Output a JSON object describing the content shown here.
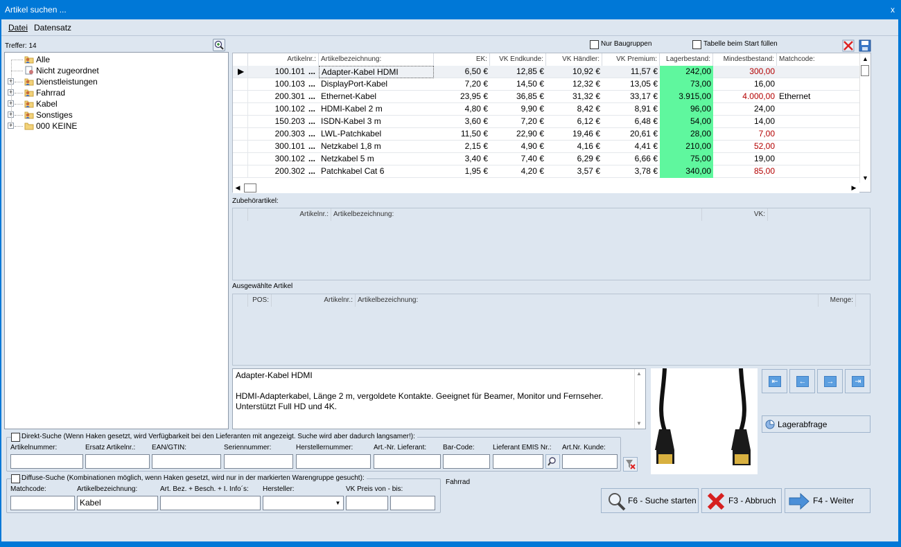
{
  "window": {
    "title": "Artikel suchen ...",
    "close_glyph": "x"
  },
  "menu": {
    "datei": "Datei",
    "datensatz": "Datensatz"
  },
  "tree": {
    "treffer": "Treffer: 14",
    "items": [
      {
        "label": "Alle",
        "icon": "folder-user-icon",
        "expandable": false
      },
      {
        "label": "Nicht zugeordnet",
        "icon": "document-icon",
        "expandable": false
      },
      {
        "label": "Dienstleistungen",
        "icon": "folder-user-icon",
        "expandable": true
      },
      {
        "label": "Fahrrad",
        "icon": "folder-user-icon",
        "expandable": true
      },
      {
        "label": "Kabel",
        "icon": "folder-user-icon",
        "expandable": true
      },
      {
        "label": "Sonstiges",
        "icon": "folder-user-icon",
        "expandable": true
      },
      {
        "label": "000 KEINE",
        "icon": "folder-icon",
        "expandable": true
      }
    ]
  },
  "options": {
    "nur_baugruppen": "Nur Baugruppen",
    "tabelle_fuellen": "Tabelle beim Start füllen"
  },
  "grid": {
    "headers": [
      "Artikelnr.:",
      "Artikelbezeichnung:",
      "EK:",
      "VK Endkunde:",
      "VK Händler:",
      "VK Premium:",
      "Lagerbestand:",
      "Mindestbestand:",
      "Matchcode:"
    ],
    "rows": [
      {
        "nr": "100.101",
        "name": "Adapter-Kabel HDMI",
        "ek": "6,50 €",
        "vke": "12,85 €",
        "vkh": "10,92 €",
        "vkp": "11,57 €",
        "lager": "242,00",
        "mind": "300,00",
        "mind_red": true,
        "match": "",
        "selected": true
      },
      {
        "nr": "100.103",
        "name": "DisplayPort-Kabel",
        "ek": "7,20 €",
        "vke": "14,50 €",
        "vkh": "12,32 €",
        "vkp": "13,05 €",
        "lager": "73,00",
        "mind": "16,00",
        "mind_red": false,
        "match": ""
      },
      {
        "nr": "200.301",
        "name": "Ethernet-Kabel",
        "ek": "23,95 €",
        "vke": "36,85 €",
        "vkh": "31,32 €",
        "vkp": "33,17 €",
        "lager": "3.915,00",
        "mind": "4.000,00",
        "mind_red": true,
        "match": "Ethernet"
      },
      {
        "nr": "100.102",
        "name": "HDMI-Kabel 2 m",
        "ek": "4,80 €",
        "vke": "9,90 €",
        "vkh": "8,42 €",
        "vkp": "8,91 €",
        "lager": "96,00",
        "mind": "24,00",
        "mind_red": false,
        "match": ""
      },
      {
        "nr": "150.203",
        "name": "ISDN-Kabel 3 m",
        "ek": "3,60 €",
        "vke": "7,20 €",
        "vkh": "6,12 €",
        "vkp": "6,48 €",
        "lager": "54,00",
        "mind": "14,00",
        "mind_red": false,
        "match": ""
      },
      {
        "nr": "200.303",
        "name": "LWL-Patchkabel",
        "ek": "11,50 €",
        "vke": "22,90 €",
        "vkh": "19,46 €",
        "vkp": "20,61 €",
        "lager": "28,00",
        "mind": "7,00",
        "mind_red": true,
        "match": ""
      },
      {
        "nr": "300.101",
        "name": "Netzkabel 1,8 m",
        "ek": "2,15 €",
        "vke": "4,90 €",
        "vkh": "4,16 €",
        "vkp": "4,41 €",
        "lager": "210,00",
        "mind": "52,00",
        "mind_red": true,
        "match": ""
      },
      {
        "nr": "300.102",
        "name": "Netzkabel 5 m",
        "ek": "3,40 €",
        "vke": "7,40 €",
        "vkh": "6,29 €",
        "vkp": "6,66 €",
        "lager": "75,00",
        "mind": "19,00",
        "mind_red": false,
        "match": ""
      },
      {
        "nr": "200.302",
        "name": "Patchkabel Cat 6",
        "ek": "1,95 €",
        "vke": "4,20 €",
        "vkh": "3,57 €",
        "vkp": "3,78 €",
        "lager": "340,00",
        "mind": "85,00",
        "mind_red": true,
        "match": ""
      }
    ]
  },
  "zubehoer": {
    "title": "Zubehörartikel:",
    "headers": [
      "Artikelnr.:",
      "Artikelbezeichnung:",
      "VK:"
    ]
  },
  "ausgewaehlt": {
    "title": "Ausgewählte Artikel",
    "headers": [
      "POS:",
      "Artikelnr.:",
      "Artikelbezeichnung:",
      "Menge:"
    ]
  },
  "description": {
    "title": "Adapter-Kabel HDMI",
    "text": "HDMI-Adapterkabel, Länge 2 m, vergoldete Kontakte. Geeignet für Beamer, Monitor und Fernseher. Unterstützt Full HD und 4K."
  },
  "buttons": {
    "lagerabfrage": "Lagerabfrage",
    "suche": "F6 - Suche starten",
    "abbruch": "F3 - Abbruch",
    "weiter": "F4 - Weiter"
  },
  "direkt": {
    "label": "Direkt-Suche (Wenn Haken gesetzt, wird Verfügbarkeit bei den Lieferanten mit angezeigt. Suche wird aber dadurch langsamer!):",
    "fields": [
      "Artikelnummer:",
      "Ersatz Artikelnr.:",
      "EAN/GTIN:",
      "Seriennummer:",
      "Herstellernummer:",
      "Art.-Nr. Lieferant:",
      "Bar-Code:",
      "Lieferant EMIS Nr.:",
      "Art.Nr. Kunde:"
    ]
  },
  "diffuse": {
    "label": "Diffuse-Suche (Kombinationen möglich, wenn Haken gesetzt, wird nur in der markierten Warengruppe gesucht):",
    "fields": [
      "Matchcode:",
      "Artikelbezeichnung:",
      "Art. Bez. + Besch. + I. Info´s:",
      "Hersteller:",
      "VK Preis von - bis:"
    ],
    "artikelbezeichnung_value": "Kabel"
  },
  "warengruppe": "Fahrrad",
  "colors": {
    "accent": "#0078d7",
    "stock_green": "#5ff79e",
    "warn_red": "#b40000",
    "panel": "#dde6f0"
  }
}
